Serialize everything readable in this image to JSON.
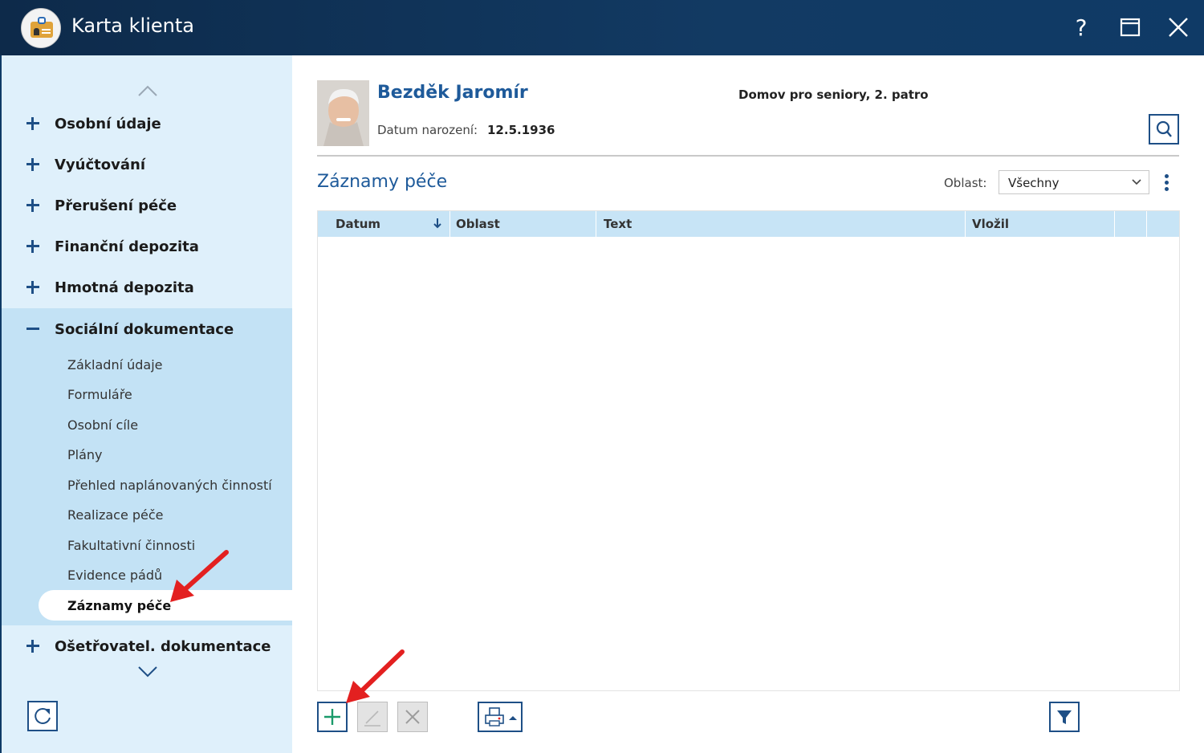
{
  "window": {
    "title": "Karta klienta",
    "help_label": "?"
  },
  "sidebar": {
    "groups": [
      {
        "label": "Osobní údaje",
        "state": "collapsed"
      },
      {
        "label": "Vyúčtování",
        "state": "collapsed"
      },
      {
        "label": "Přerušení péče",
        "state": "collapsed"
      },
      {
        "label": "Finanční depozita",
        "state": "collapsed"
      },
      {
        "label": "Hmotná depozita",
        "state": "collapsed"
      },
      {
        "label": "Sociální dokumentace",
        "state": "expanded"
      },
      {
        "label": "Ošetřovatel. dokumentace",
        "state": "collapsed"
      }
    ],
    "sub_items": [
      "Základní údaje",
      "Formuláře",
      "Osobní cíle",
      "Plány",
      "Přehled naplánovaných činností",
      "Realizace péče",
      "Fakultativní činnosti",
      "Evidence pádů"
    ],
    "active_sub_item": "Záznamy péče"
  },
  "client": {
    "name": "Bezděk Jaromír",
    "dob_label": "Datum narození:",
    "dob_value": "12.5.1936",
    "facility": "Domov pro seniory, 2. patro"
  },
  "section": {
    "title": "Záznamy péče",
    "area_label": "Oblast:",
    "area_value": "Všechny"
  },
  "table": {
    "columns": [
      "Datum",
      "Oblast",
      "Text",
      "Vložil"
    ],
    "sort_column": "Datum",
    "sort_direction": "descending",
    "rows": []
  },
  "icons": {
    "app": "client-card-icon",
    "maximize": "maximize-icon",
    "close": "close-icon",
    "scroll_up": "chevron-up-icon",
    "scroll_down": "chevron-down-icon",
    "refresh": "refresh-icon",
    "search": "search-icon",
    "more": "kebab-menu-icon",
    "add": "plus-icon",
    "edit": "pencil-icon",
    "delete": "x-icon",
    "print": "printer-icon",
    "filter": "filter-icon",
    "annotation": "red-arrow-icon"
  },
  "colors": {
    "titlebar": "#123a63",
    "accent": "#1e4f86",
    "heading": "#1e5a9a",
    "sidebar_bg": "#dff0fb",
    "sidebar_expanded_bg": "#c3e2f5",
    "grid_header_bg": "#c7e4f6",
    "annotation_red": "#e32020"
  }
}
